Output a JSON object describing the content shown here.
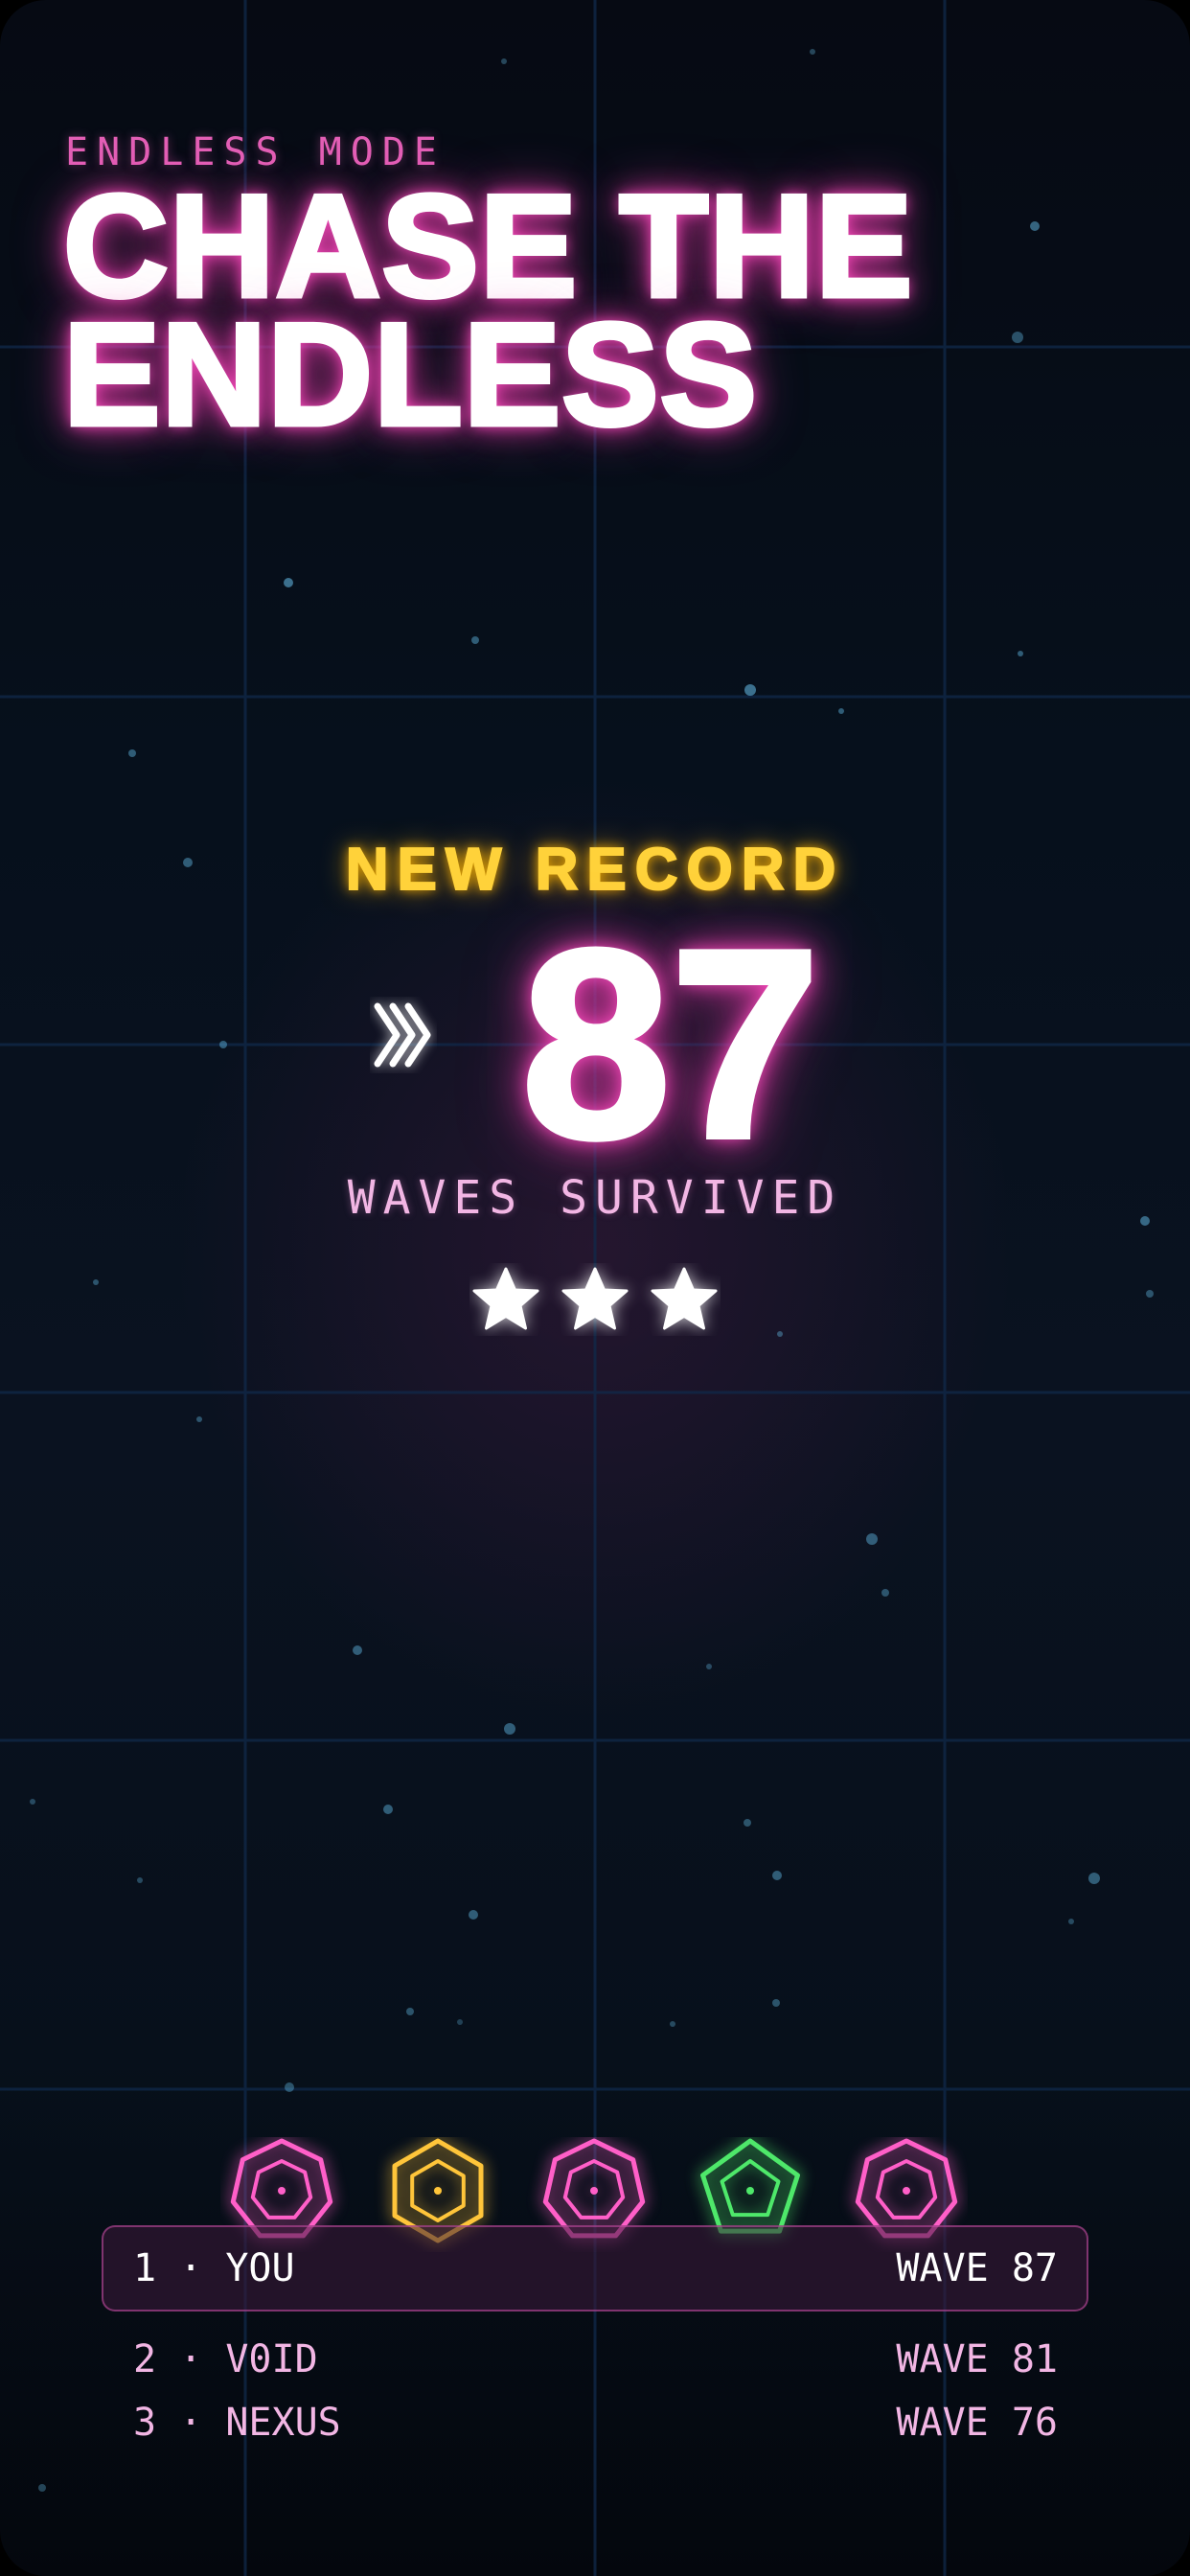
{
  "header": {
    "mode_label": "ENDLESS MODE",
    "title_line1": "CHASE THE",
    "title_line2": "ENDLESS"
  },
  "result": {
    "record_label": "NEW RECORD",
    "waves": "87",
    "waves_label": "WAVES SURVIVED",
    "stars_earned": 3,
    "stars_total": 3
  },
  "enemies": [
    {
      "shape": "heptagon",
      "color": "#ff5fc8"
    },
    {
      "shape": "hexagon",
      "color": "#ffc53a"
    },
    {
      "shape": "heptagon",
      "color": "#ff5fc8"
    },
    {
      "shape": "pentagon",
      "color": "#4ee86a"
    },
    {
      "shape": "heptagon",
      "color": "#ff5fc8"
    }
  ],
  "leaderboard": [
    {
      "name": "1 · YOU",
      "wave": "WAVE 87"
    },
    {
      "name": "2 · V0ID",
      "wave": "WAVE 81"
    },
    {
      "name": "3 · NEXUS",
      "wave": "WAVE 76"
    }
  ],
  "icons": {
    "progress": "triple-chevron-right-icon",
    "rating": "star-icon"
  },
  "colors": {
    "accent_pink": "#ff4fc2",
    "record_gold": "#ffd23a",
    "text_pink": "#f2b6e4"
  }
}
